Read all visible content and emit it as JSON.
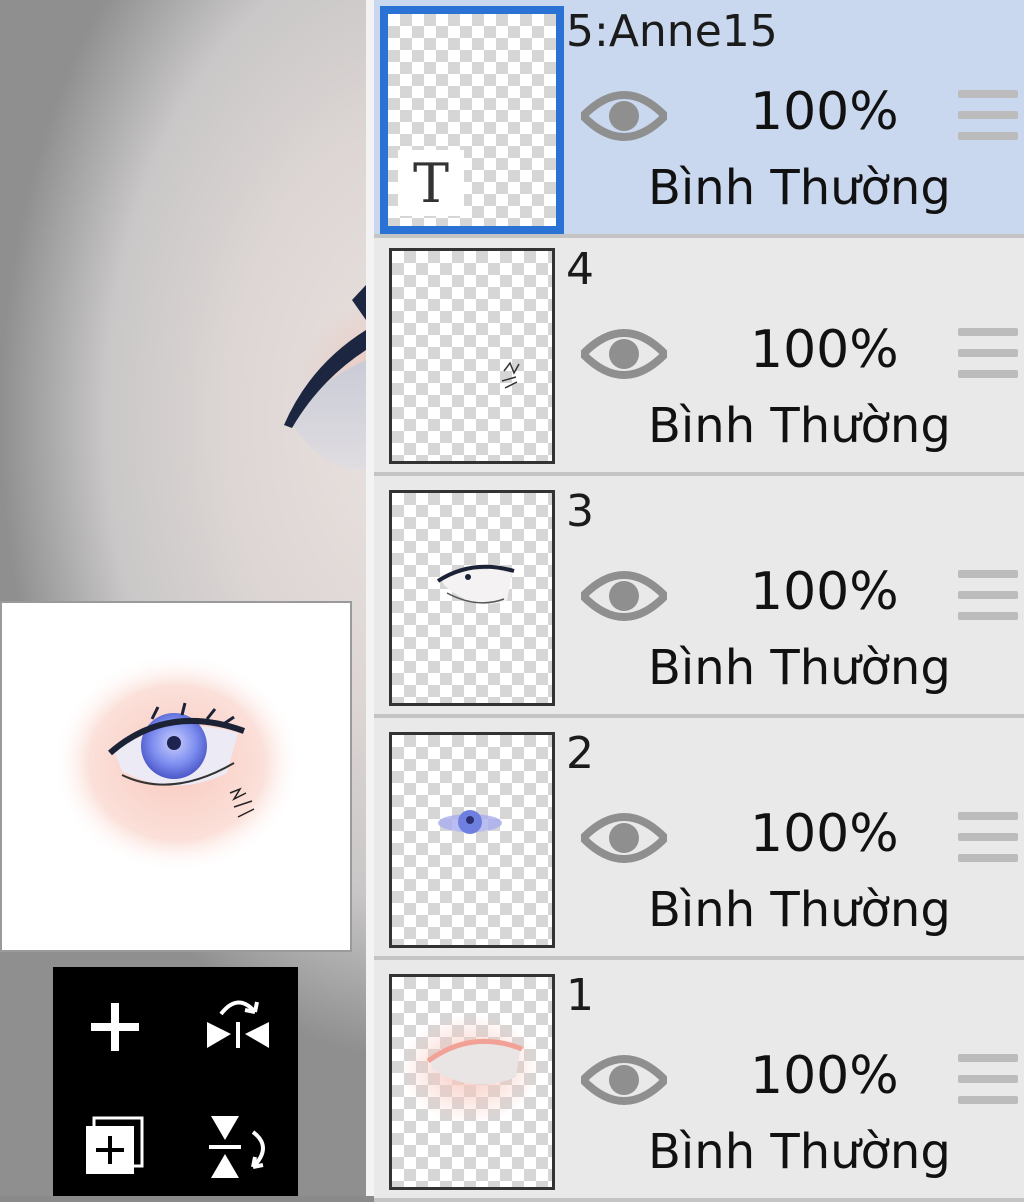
{
  "layers": [
    {
      "name": "5:Anne15",
      "opacity": "100%",
      "blend": "Bình Thường",
      "selected": true,
      "badge": "T"
    },
    {
      "name": "4",
      "opacity": "100%",
      "blend": "Bình Thường",
      "selected": false
    },
    {
      "name": "3",
      "opacity": "100%",
      "blend": "Bình Thường",
      "selected": false
    },
    {
      "name": "2",
      "opacity": "100%",
      "blend": "Bình Thường",
      "selected": false
    },
    {
      "name": "1",
      "opacity": "100%",
      "blend": "Bình Thường",
      "selected": false
    }
  ],
  "colors": {
    "selected_bg": "#c9d8ee",
    "selected_border": "#2a73d4",
    "panel_bg": "#e9e9e9",
    "iris": "#6f7fe0"
  },
  "toolbar": {
    "icons": [
      "plus-icon",
      "flip-horizontal-icon",
      "duplicate-layer-icon",
      "flip-vertical-icon"
    ]
  }
}
